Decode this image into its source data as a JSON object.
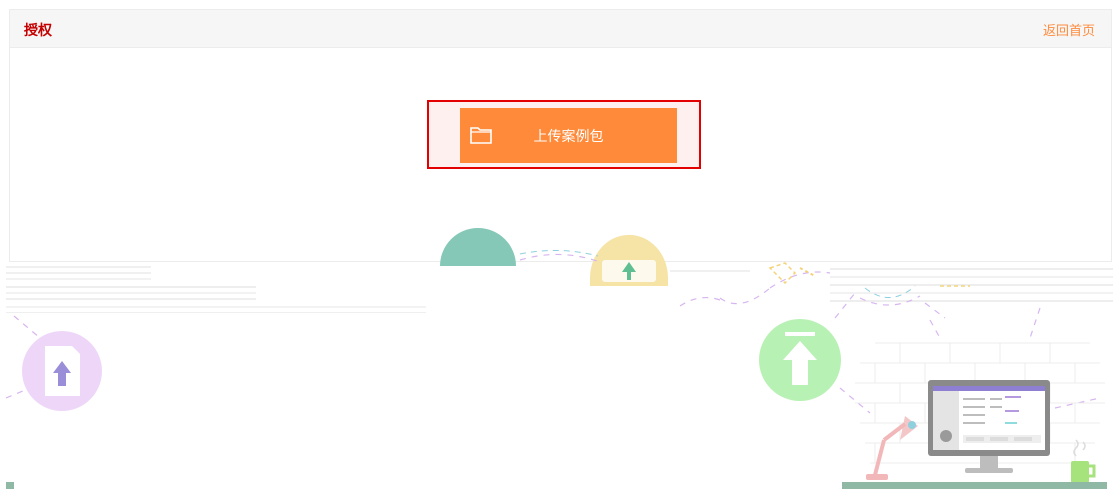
{
  "header": {
    "title": "授权",
    "home_link": "返回首页"
  },
  "upload": {
    "button_label": "上传案例包",
    "icon": "folder-icon"
  },
  "illustration": {
    "icons": [
      "teal-circle-icon",
      "upload-arrow-icon",
      "document-upload-icon",
      "green-upload-icon",
      "desk-lamp-icon",
      "monitor-icon",
      "mug-icon"
    ]
  },
  "colors": {
    "title": "#c40000",
    "link": "#ff8b3d",
    "button": "#ff8a3a",
    "frame": "#e30000"
  }
}
